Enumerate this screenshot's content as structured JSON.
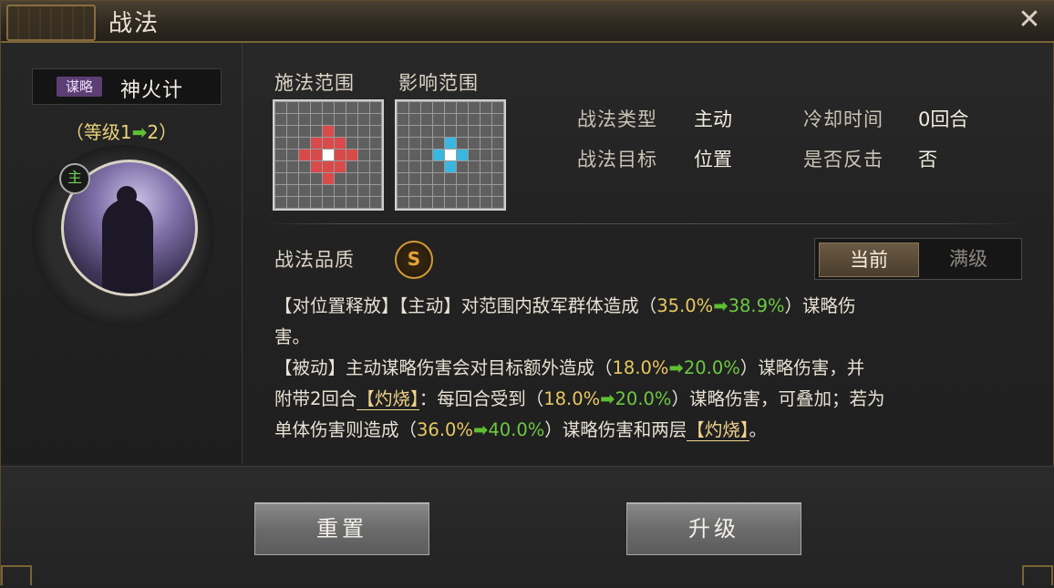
{
  "window": {
    "title": "战法",
    "close_symbol": "✕"
  },
  "left": {
    "strategy_tag": "谋略",
    "strategy_name": "神火计",
    "level_prefix": "（等级",
    "level_from": "1",
    "level_to": "2",
    "level_suffix": "）",
    "main_badge": "主"
  },
  "range": {
    "cast_label": "施法范围",
    "effect_label": "影响范围"
  },
  "attributes": {
    "type_label": "战法类型",
    "type_value": "主动",
    "cooldown_label": "冷却时间",
    "cooldown_value": "0回合",
    "target_label": "战法目标",
    "target_value": "位置",
    "counter_label": "是否反击",
    "counter_value": "否"
  },
  "quality": {
    "label": "战法品质",
    "grade": "S"
  },
  "toggle": {
    "current": "当前",
    "max": "满级"
  },
  "description": {
    "l1a": "【对位置释放】【主动】对范围内敌军群体造成（",
    "v1a": "35.0%",
    "v1b": "38.9%",
    "l1b": "）谋略伤",
    "l2": "害。",
    "l3a": "【被动】主动谋略伤害会对目标额外造成（",
    "v2a": "18.0%",
    "v2b": "20.0%",
    "l3b": "）谋略伤害，并",
    "l4a": "附带2回合",
    "burn1": "【灼烧】",
    "l4b": "：每回合受到（",
    "v3a": "18.0%",
    "v3b": "20.0%",
    "l4c": "）谋略伤害，可叠加；若为",
    "l5a": "单体伤害则造成（",
    "v4a": "36.0%",
    "v4b": "40.0%",
    "l5b": "）谋略伤害和两层",
    "burn2": "【灼烧】",
    "l5c": "。"
  },
  "buttons": {
    "reset": "重置",
    "upgrade": "升级"
  },
  "colors": {
    "accent_gold": "#e8c860",
    "accent_green": "#6cc843",
    "cast_cells": "#d94a4a",
    "effect_cells": "#3ab6e0"
  }
}
